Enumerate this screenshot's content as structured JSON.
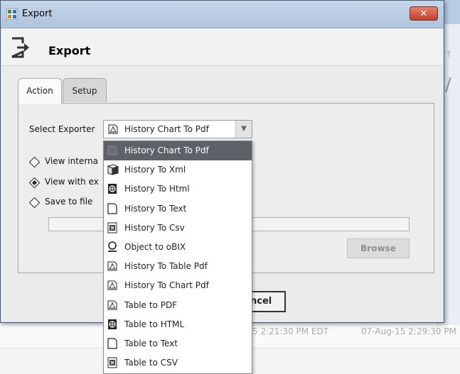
{
  "window": {
    "title": "Export",
    "close_glyph": "✕"
  },
  "header": {
    "title": "Export"
  },
  "tabs": [
    {
      "label": "Action",
      "active": true
    },
    {
      "label": "Setup",
      "active": false
    }
  ],
  "form": {
    "select_label": "Select Exporter",
    "selected_value": "History Chart To Pdf",
    "selected_icon": "pdf-icon",
    "options_visible": [
      {
        "label": "View interna",
        "checked": false
      },
      {
        "label": "View with ex",
        "checked": true
      },
      {
        "label": "Save to file",
        "checked": false
      }
    ],
    "browse_label": "Browse",
    "cancel_label": "ncel"
  },
  "dropdown": {
    "items": [
      {
        "label": "History Chart To Pdf",
        "icon": "pdf-icon",
        "selected": true
      },
      {
        "label": "History To Xml",
        "icon": "xml-icon",
        "selected": false
      },
      {
        "label": "History To Html",
        "icon": "html-icon",
        "selected": false
      },
      {
        "label": "History To Text",
        "icon": "text-icon",
        "selected": false
      },
      {
        "label": "History To Csv",
        "icon": "csv-icon",
        "selected": false
      },
      {
        "label": "Object to oBIX",
        "icon": "obix-icon",
        "selected": false
      },
      {
        "label": "History To Table Pdf",
        "icon": "pdf-icon",
        "selected": false
      },
      {
        "label": "History To Chart Pdf",
        "icon": "pdf-icon",
        "selected": false
      },
      {
        "label": "Table to PDF",
        "icon": "pdf-icon",
        "selected": false
      },
      {
        "label": "Table to HTML",
        "icon": "html-icon",
        "selected": false
      },
      {
        "label": "Table to Text",
        "icon": "text-icon",
        "selected": false
      },
      {
        "label": "Table to CSV",
        "icon": "csv-icon",
        "selected": false
      }
    ]
  },
  "background": {
    "timestamp_1": "5 2:21:30 PM EDT",
    "timestamp_2": "07-Aug-15 2:29:30 PM"
  },
  "colors": {
    "titlebar": "#b9cce6",
    "close_button": "#c9503a",
    "dropdown_selected": "#5d6168"
  }
}
